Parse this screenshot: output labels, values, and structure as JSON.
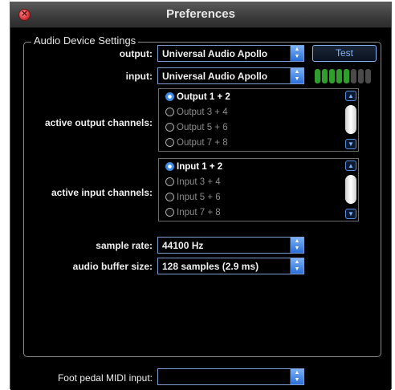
{
  "window": {
    "title": "Preferences"
  },
  "audio": {
    "legend": "Audio Device Settings",
    "output_label": "output:",
    "output_value": "Universal Audio Apollo",
    "input_label": "input:",
    "input_value": "Universal Audio Apollo",
    "test_label": "Test",
    "meter": {
      "lit_count": 5,
      "total": 8,
      "lit_color": "#2f9e2a",
      "unlit_color": "#4a4a4a"
    },
    "output_channels_label": "active output channels:",
    "output_channels": [
      {
        "label": "Output 1 + 2",
        "selected": true
      },
      {
        "label": "Output 3 + 4",
        "selected": false
      },
      {
        "label": "Output 5 + 6",
        "selected": false
      },
      {
        "label": "Output 7 + 8",
        "selected": false
      }
    ],
    "input_channels_label": "active input channels:",
    "input_channels": [
      {
        "label": "Input 1 + 2",
        "selected": true
      },
      {
        "label": "Input 3 + 4",
        "selected": false
      },
      {
        "label": "Input 5 + 6",
        "selected": false
      },
      {
        "label": "Input 7 + 8",
        "selected": false
      }
    ],
    "sample_rate_label": "sample rate:",
    "sample_rate_value": "44100 Hz",
    "buffer_label": "audio buffer size:",
    "buffer_value": "128 samples (2.9 ms)"
  },
  "midi": {
    "label": "Foot pedal MIDI input:",
    "value": ""
  },
  "icons": {
    "close": "close-icon",
    "popup": "popup-arrows-icon",
    "scroll_up": "chevron-up-icon",
    "scroll_down": "chevron-down-icon"
  },
  "colors": {
    "accent": "#3a7fd8",
    "background": "#000000"
  }
}
